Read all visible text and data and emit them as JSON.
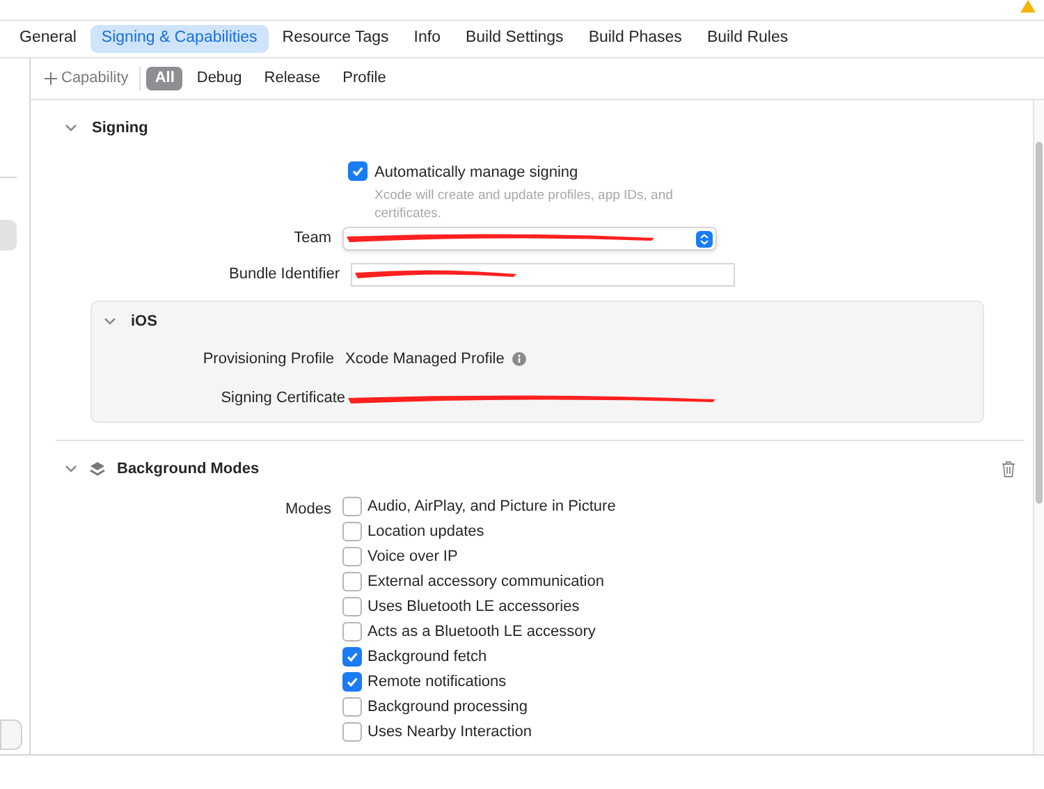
{
  "tabs": [
    {
      "label": "General",
      "selected": false
    },
    {
      "label": "Signing & Capabilities",
      "selected": true
    },
    {
      "label": "Resource Tags",
      "selected": false
    },
    {
      "label": "Info",
      "selected": false
    },
    {
      "label": "Build Settings",
      "selected": false
    },
    {
      "label": "Build Phases",
      "selected": false
    },
    {
      "label": "Build Rules",
      "selected": false
    }
  ],
  "toolbar": {
    "add_label": "Capability",
    "filters": [
      {
        "label": "All",
        "selected": true
      },
      {
        "label": "Debug",
        "selected": false
      },
      {
        "label": "Release",
        "selected": false
      },
      {
        "label": "Profile",
        "selected": false
      }
    ]
  },
  "signing": {
    "title": "Signing",
    "expanded": true,
    "auto_manage": {
      "label": "Automatically manage signing",
      "checked": true,
      "hint": "Xcode will create and update profiles, app IDs, and certificates."
    },
    "team_label": "Team",
    "bundle_label": "Bundle Identifier",
    "ios": {
      "title": "iOS",
      "expanded": true,
      "provisioning_label": "Provisioning Profile",
      "provisioning_value": "Xcode Managed Profile",
      "certificate_label": "Signing Certificate"
    }
  },
  "background_modes": {
    "title": "Background Modes",
    "expanded": true,
    "modes_label": "Modes",
    "modes": [
      {
        "label": "Audio, AirPlay, and Picture in Picture",
        "checked": false
      },
      {
        "label": "Location updates",
        "checked": false
      },
      {
        "label": "Voice over IP",
        "checked": false
      },
      {
        "label": "External accessory communication",
        "checked": false
      },
      {
        "label": "Uses Bluetooth LE accessories",
        "checked": false
      },
      {
        "label": "Acts as a Bluetooth LE accessory",
        "checked": false
      },
      {
        "label": "Background fetch",
        "checked": true
      },
      {
        "label": "Remote notifications",
        "checked": true
      },
      {
        "label": "Background processing",
        "checked": false
      },
      {
        "label": "Uses Nearby Interaction",
        "checked": false
      }
    ]
  }
}
